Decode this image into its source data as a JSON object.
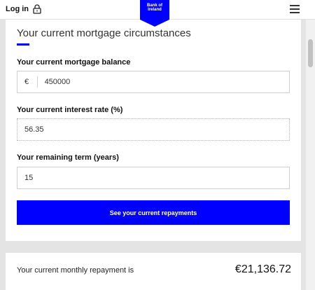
{
  "header": {
    "login_label": "Log in",
    "logo_line1": "Bank of",
    "logo_line2": "Ireland",
    "brand_color": "#0000ff"
  },
  "form": {
    "title": "Your current mortgage circumstances",
    "balance": {
      "label": "Your current mortgage balance",
      "currency": "€",
      "value": "450000"
    },
    "rate": {
      "label": "Your current interest rate (%)",
      "value": "56.35"
    },
    "term": {
      "label": "Your remaining term (years)",
      "value": "15"
    },
    "submit_label": "See your current repayments"
  },
  "result": {
    "label": "Your current monthly repayment is",
    "value": "€21,136.72"
  }
}
